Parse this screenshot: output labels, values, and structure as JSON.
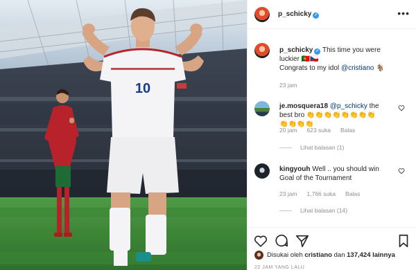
{
  "post": {
    "author": "p_schicky",
    "more_icon": "more-horizontal-icon"
  },
  "caption": {
    "username": "p_schicky",
    "text_before": " This time you were luckier 🇵🇹🇨🇿",
    "text_line2": "Congrats to my idol ",
    "mention": "@cristiano",
    "emoji_end": " 🐐",
    "time": "23 jam"
  },
  "comments": [
    {
      "username": "je.mosquera18",
      "mention": "@p_schicky",
      "text": " the best bro 👏👏👏👏👏👏👏👏👏👏👏👏",
      "time": "20 jam",
      "likes": "623 suka",
      "reply": "Balas",
      "view_replies": "Lihat balasan (1)"
    },
    {
      "username": "kingyouh",
      "text": " Well .. you should win Goal of the Tournament",
      "time": "23 jam",
      "likes": "1,766 suka",
      "reply": "Balas",
      "view_replies": "Lihat balasan (14)"
    }
  ],
  "actions": {
    "like_icon": "heart-icon",
    "comment_icon": "comment-icon",
    "share_icon": "send-icon",
    "save_icon": "bookmark-icon"
  },
  "likes_line": {
    "prefix": "Disukai oleh ",
    "user": "cristiano",
    "middle": " dan ",
    "count": "137,424 lainnya"
  },
  "timestamp": "22 JAM YANG LALU",
  "photo": {
    "jersey_number": "10",
    "sky_color": "#bfd3e6",
    "pitch_color": "#3f8f3a",
    "kit_white": "#f4f4f6",
    "kit_red": "#b8232b"
  }
}
